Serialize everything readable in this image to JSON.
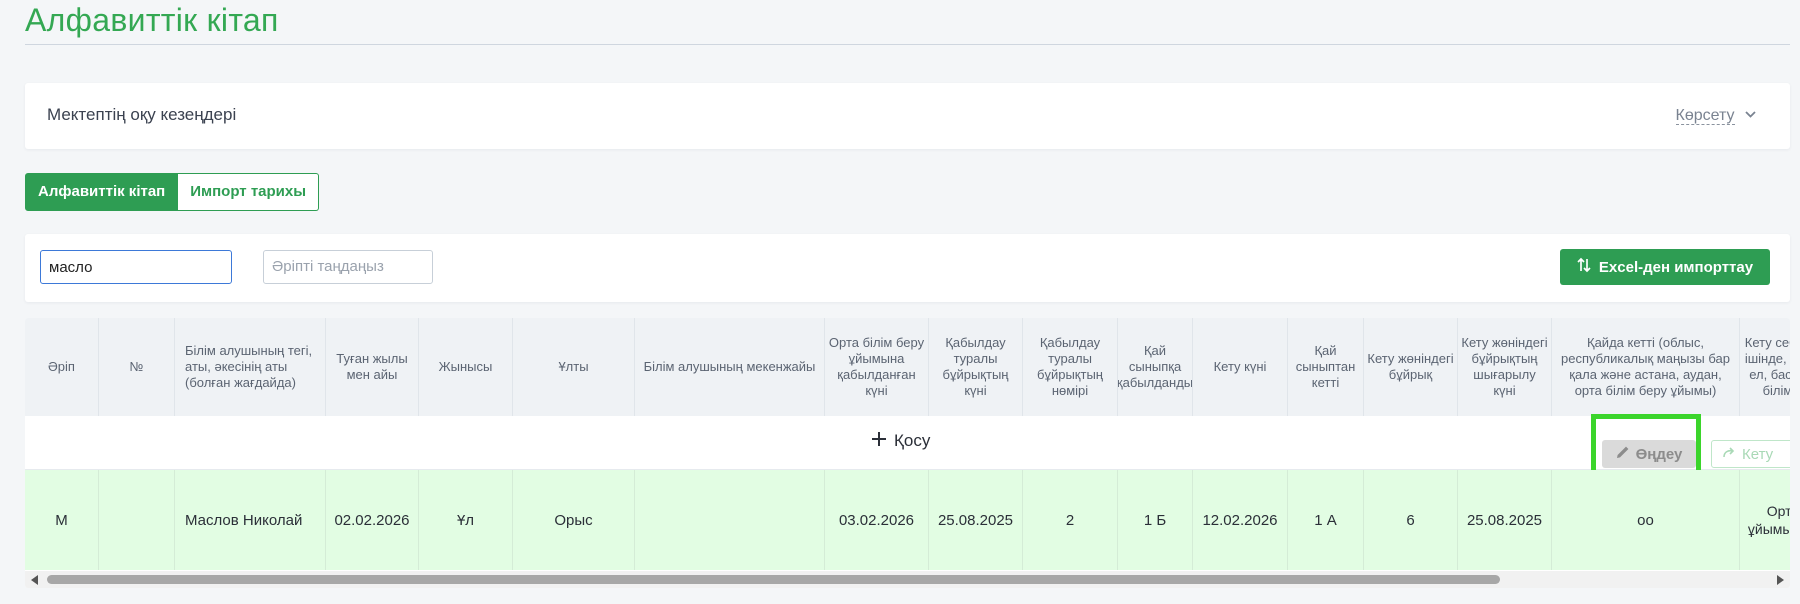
{
  "page": {
    "title": "Алфавиттік кітап"
  },
  "periods": {
    "title": "Мектептің оқу кезеңдері",
    "show_label": "Көрсету"
  },
  "tabs": [
    {
      "label": "Алфавиттік кітап",
      "active": true
    },
    {
      "label": "Импорт тарихы",
      "active": false
    }
  ],
  "filters": {
    "search_value": "масло",
    "letter_placeholder": "Әріпті таңдаңыз",
    "import_label": "Excel-ден импорттау"
  },
  "table": {
    "columns": [
      "Әріп",
      "№",
      "Білім алушының тегі, аты, әкесінің аты (болған жағдайда)",
      "Туған жылы мен айы",
      "Жынысы",
      "Ұлты",
      "Білім алушының мекенжайы",
      "Орта білім беру ұйымына қабылданған күні",
      "Қабылдау туралы бұйрықтың күні",
      "Қабылдау туралы бұйрықтың нөмірі",
      "Қай сыныпқа қабылданды",
      "Кету күні",
      "Қай сыныптан кетті",
      "Кету жөніндегі бұйрық",
      "Кету жөніндегі бұйрықтың шығарылу күні",
      "Қайда кетті (облыс, республикалық маңызы бар қала және астана, аудан, орта білім беру ұйымы)",
      "Кету себебі (республика ішінде, ТМД елдері, шет ел, басқа түрлері, орта білім беру ұйымы)"
    ],
    "add_label": "Қосу",
    "edit_label": "Өңдеу",
    "leave_label": "Кету",
    "rows": [
      {
        "cells": [
          "М",
          "",
          "Маслов Николай",
          "02.02.2026",
          "Ұл",
          "Орыс",
          "",
          "03.02.2026",
          "25.08.2025",
          "2",
          "1 Б",
          "12.02.2026",
          "1 А",
          "6",
          "25.08.2025",
          "оо",
          "Орта білім беру ұйымының негізі сайт"
        ]
      }
    ]
  },
  "colors": {
    "accent": "#2e9d53",
    "title": "#34a853",
    "row_highlight": "#e2fde3",
    "focus_box": "#3bd52b"
  }
}
